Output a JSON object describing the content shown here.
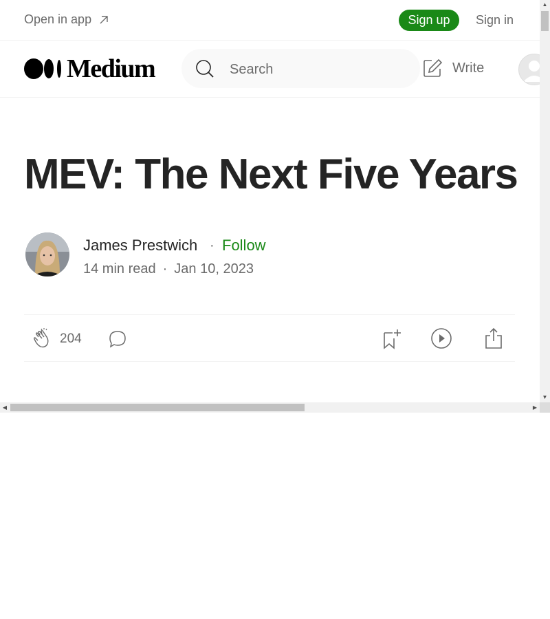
{
  "topbar": {
    "open_in_app": "Open in app",
    "sign_up": "Sign up",
    "sign_in": "Sign in"
  },
  "header": {
    "brand": "Medium",
    "search_placeholder": "Search",
    "write": "Write"
  },
  "article": {
    "title": "MEV: The Next Five Years",
    "author": "James Prestwich",
    "follow": "Follow",
    "read_time": "14 min read",
    "date": "Jan 10, 2023"
  },
  "actions": {
    "claps": "204"
  },
  "colors": {
    "accent_green": "#1a8917",
    "text_primary": "#242424",
    "text_secondary": "#6b6b6b"
  },
  "icons": [
    "arrow-up-right-icon",
    "medium-logo-icon",
    "search-icon",
    "write-icon",
    "user-avatar-icon",
    "clap-icon",
    "comment-icon",
    "bookmark-icon",
    "listen-icon",
    "share-icon"
  ]
}
